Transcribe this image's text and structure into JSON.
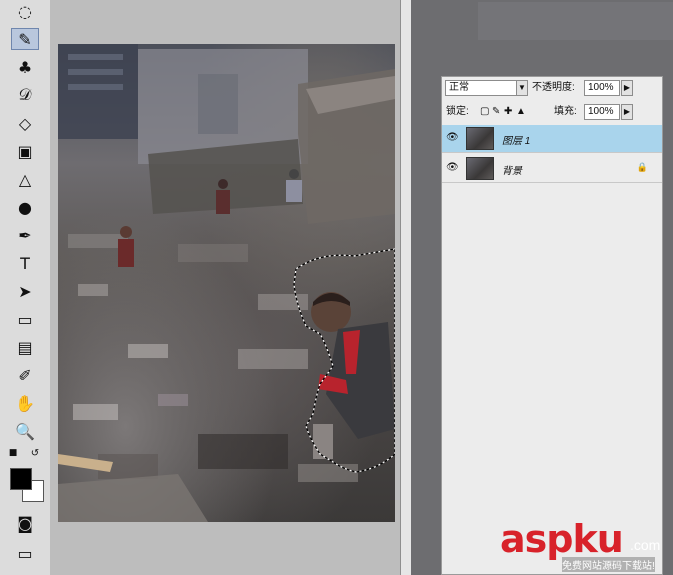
{
  "toolbox": {
    "tools": [
      {
        "icon": "lasso-icon",
        "glyph": "◌"
      },
      {
        "icon": "brush-icon",
        "glyph": "✎"
      },
      {
        "icon": "stamp-icon",
        "glyph": "♣"
      },
      {
        "icon": "history-brush-icon",
        "glyph": "𝒟"
      },
      {
        "icon": "eraser-icon",
        "glyph": "◇"
      },
      {
        "icon": "gradient-icon",
        "glyph": "▣"
      },
      {
        "icon": "blur-icon",
        "glyph": "△"
      },
      {
        "icon": "dodge-icon",
        "glyph": "●"
      },
      {
        "icon": "pen-icon",
        "glyph": "✒"
      },
      {
        "icon": "type-icon",
        "glyph": "T"
      },
      {
        "icon": "path-select-icon",
        "glyph": "➤"
      },
      {
        "icon": "shape-icon",
        "glyph": "▭"
      },
      {
        "icon": "notes-icon",
        "glyph": "▤"
      },
      {
        "icon": "eyedropper-icon",
        "glyph": "✐"
      },
      {
        "icon": "hand-icon",
        "glyph": "✋"
      },
      {
        "icon": "zoom-icon",
        "glyph": "🔍"
      }
    ],
    "active_tool": "brush-icon",
    "foreground_color": "#000000",
    "background_color": "#ffffff"
  },
  "layers_panel": {
    "blend_mode": "正常",
    "opacity_label": "不透明度:",
    "opacity_value": "100%",
    "lock_label": "锁定:",
    "fill_label": "填充:",
    "fill_value": "100%",
    "layers": [
      {
        "name": "图层 1",
        "selected": true,
        "locked": false
      },
      {
        "name": "背景",
        "selected": false,
        "locked": true
      }
    ]
  },
  "watermark": {
    "main": "aspku",
    "suffix": ".com",
    "subtitle": "免费网站源码下载站!"
  }
}
